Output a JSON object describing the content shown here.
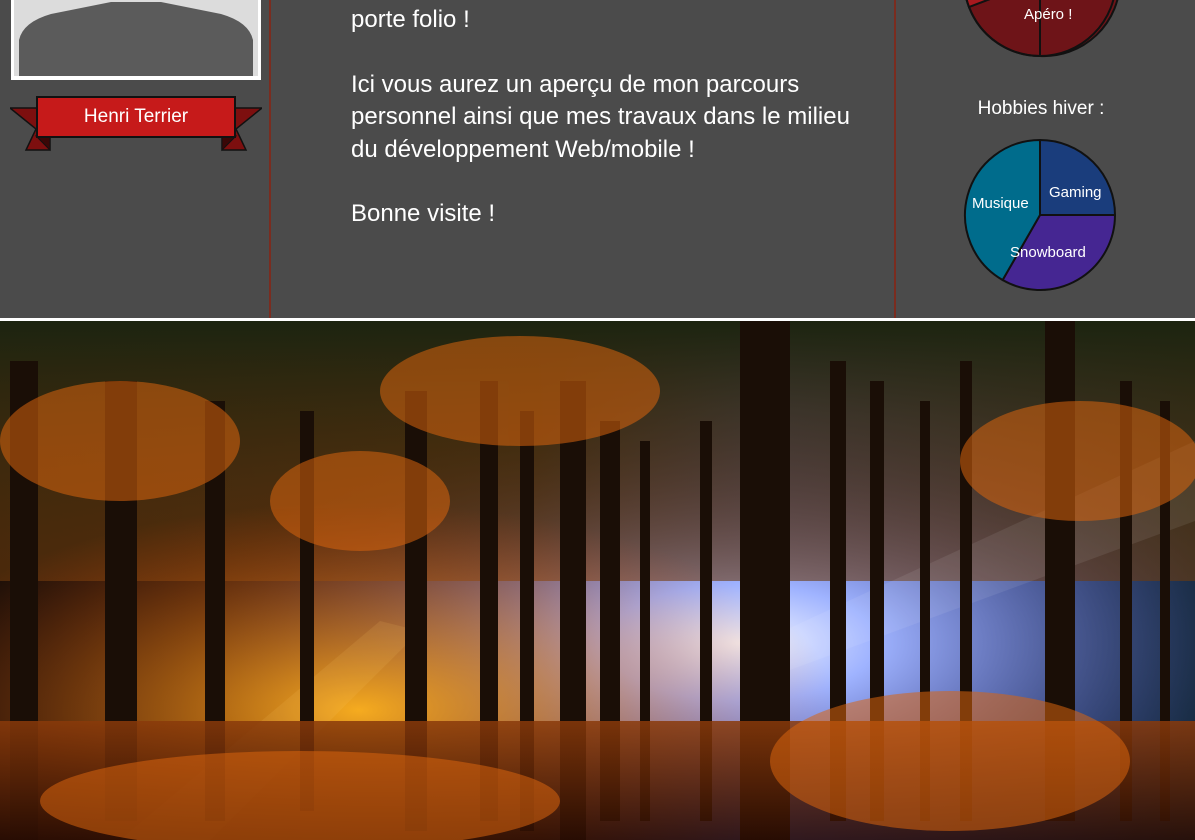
{
  "profile": {
    "name": "Henri Terrier"
  },
  "intro": {
    "line_partial": "porte folio !",
    "paragraph2": "Ici vous aurez un aperçu de mon parcours personnel ainsi que mes travaux dans le milieu du développement Web/mobile !",
    "paragraph3": "Bonne visite !"
  },
  "hobbies": {
    "summer_chart_visible_label": "Apéro !",
    "winter_title": "Hobbies hiver :",
    "winter_labels": [
      "Gaming",
      "Musique",
      "Snowboard"
    ]
  },
  "chart_data": [
    {
      "type": "pie",
      "title": "",
      "categories": [
        "Apéro !"
      ],
      "values": [],
      "colors": [
        "#6e1418",
        "#a8191f"
      ]
    },
    {
      "type": "pie",
      "title": "Hobbies hiver :",
      "categories": [
        "Gaming",
        "Snowboard",
        "Musique"
      ],
      "values": [
        25,
        33.3,
        41.7
      ],
      "colors": [
        "#1a3d7c",
        "#452692",
        "#006c8c"
      ]
    }
  ],
  "colors": {
    "panel_bg": "#4b4b4b",
    "divider": "#7a2c1f",
    "ribbon_red": "#c61a1a",
    "ribbon_dark": "#7d0f0f"
  }
}
